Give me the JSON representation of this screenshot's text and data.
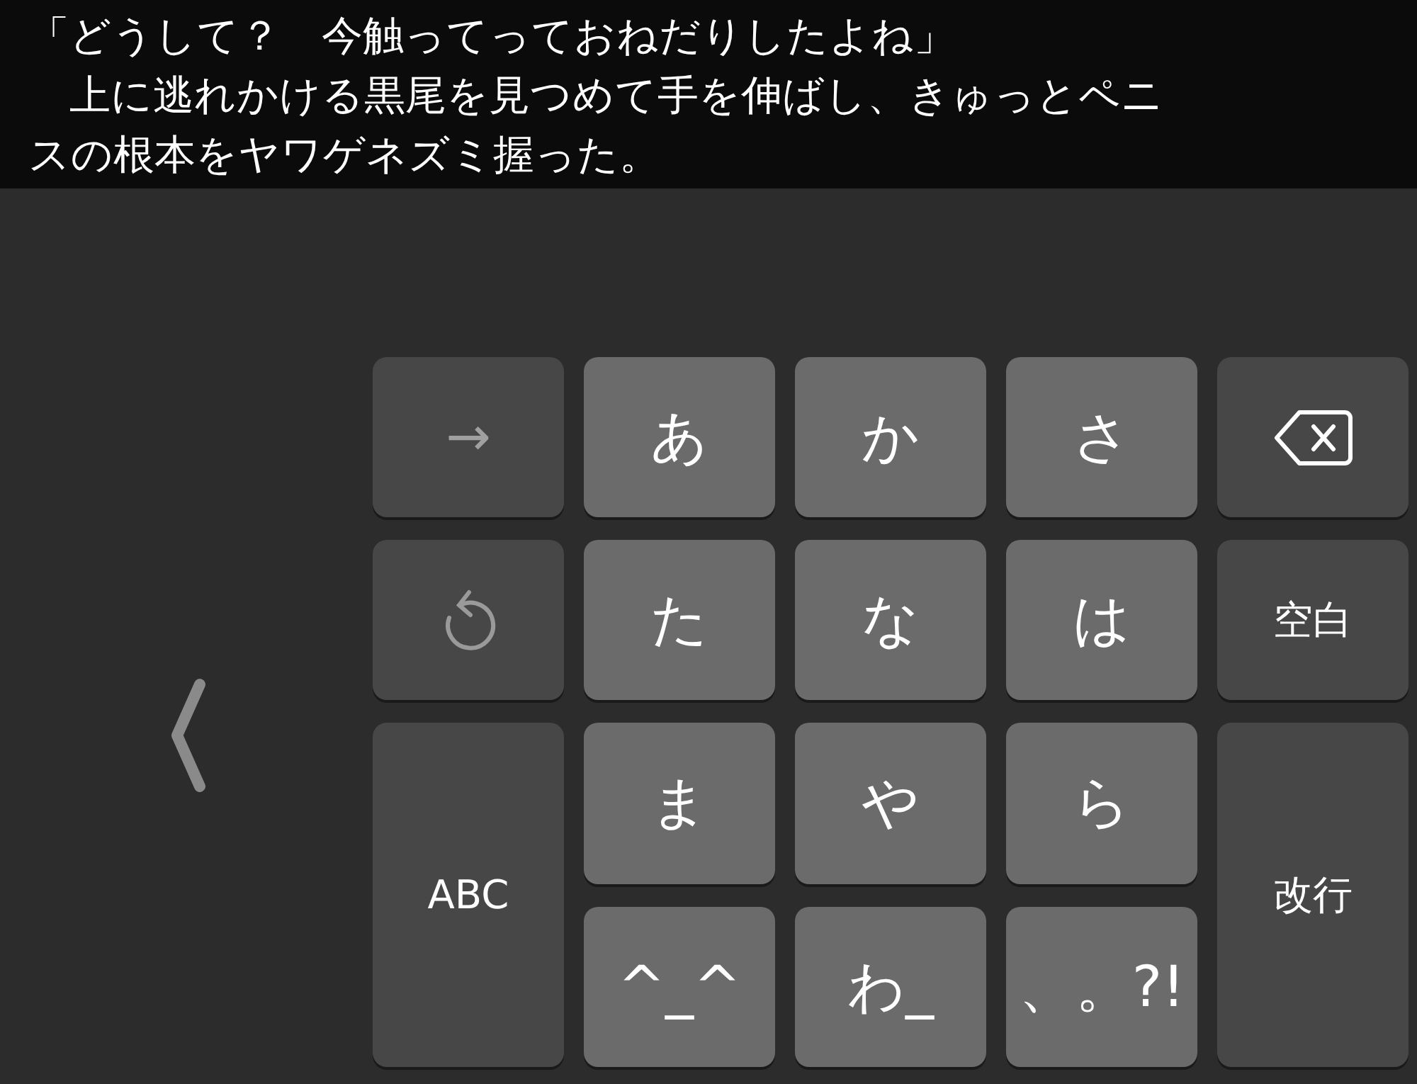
{
  "text_view": {
    "lines": [
      "「どうして？　今触ってっておねだりしたよね」",
      "　上に逃れかける黒尾を見つめて手を伸ばし、きゅっとペニ",
      "スの根本をヤワゲネズミ握った。"
    ]
  },
  "keyboard": {
    "keys": [
      {
        "kind": "function",
        "label": "→"
      },
      {
        "kind": "kana",
        "label": "あ"
      },
      {
        "kind": "kana",
        "label": "か"
      },
      {
        "kind": "kana",
        "label": "さ"
      },
      {
        "kind": "delete"
      },
      {
        "kind": "undo"
      },
      {
        "kind": "kana",
        "label": "た"
      },
      {
        "kind": "kana",
        "label": "な"
      },
      {
        "kind": "kana",
        "label": "は"
      },
      {
        "kind": "function",
        "label": "空白"
      },
      {
        "kind": "tall",
        "label": "ABC"
      },
      {
        "kind": "kana",
        "label": "ま"
      },
      {
        "kind": "kana",
        "label": "や"
      },
      {
        "kind": "kana",
        "label": "ら"
      },
      {
        "kind": "tall",
        "label": "改行"
      },
      {
        "kind": "kana",
        "label": "^_^"
      },
      {
        "kind": "kana",
        "label": "わ_"
      },
      {
        "kind": "kana",
        "label": "、。?!"
      }
    ]
  }
}
